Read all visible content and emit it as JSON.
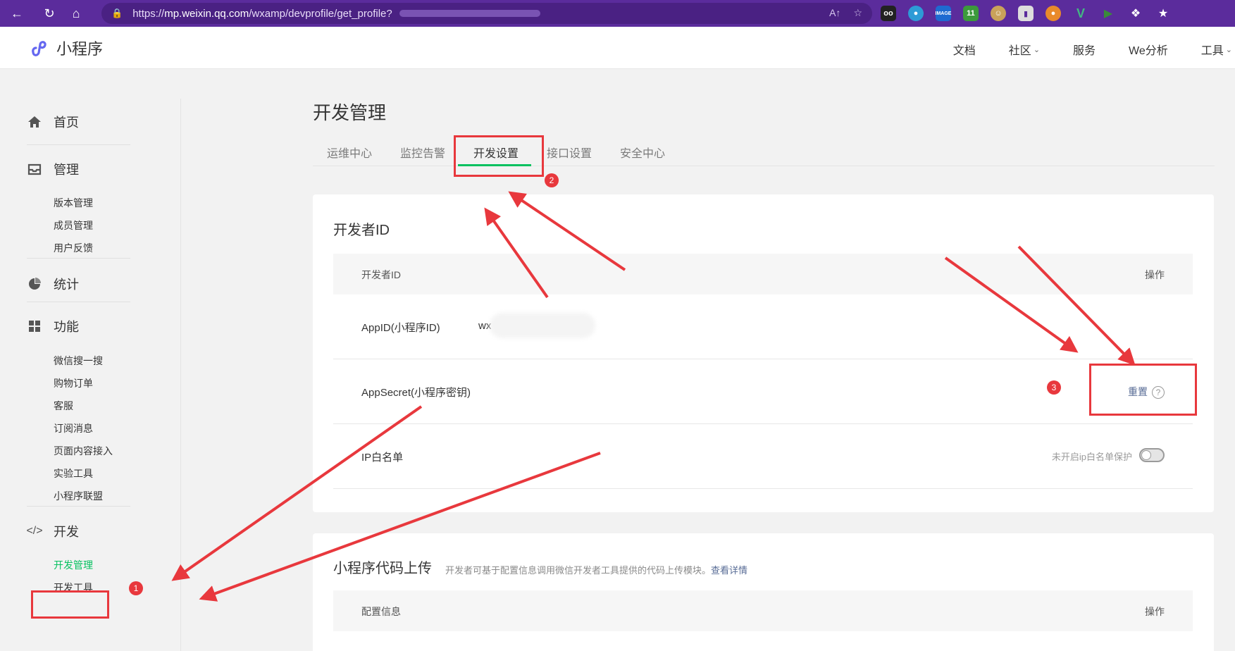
{
  "browser": {
    "url_prefix": "https://",
    "url_domain": "mp.weixin.qq.com",
    "url_path": "/wxamp/devprofile/get_profile?"
  },
  "header": {
    "logo_text": "小程序",
    "nav": [
      {
        "label": "文档"
      },
      {
        "label": "社区",
        "has_dropdown": true
      },
      {
        "label": "服务"
      },
      {
        "label": "We分析"
      },
      {
        "label": "工具",
        "has_dropdown": true
      }
    ]
  },
  "sidebar": {
    "home": "首页",
    "manage": {
      "label": "管理",
      "items": [
        "版本管理",
        "成员管理",
        "用户反馈"
      ]
    },
    "stats": "统计",
    "features": {
      "label": "功能",
      "items": [
        "微信搜一搜",
        "购物订单",
        "客服",
        "订阅消息",
        "页面内容接入",
        "实验工具",
        "小程序联盟"
      ]
    },
    "dev": {
      "label": "开发",
      "items": [
        "开发管理",
        "开发工具"
      ],
      "active": "开发管理"
    }
  },
  "main": {
    "page_title": "开发管理",
    "tabs": [
      "运维中心",
      "监控告警",
      "开发设置",
      "接口设置",
      "安全中心"
    ],
    "active_tab": "开发设置",
    "dev_id_card": {
      "title": "开发者ID",
      "col_left": "开发者ID",
      "col_right": "操作",
      "rows": {
        "appid_label": "AppID(小程序ID)",
        "appid_value": "wx",
        "appsecret_label": "AppSecret(小程序密钥)",
        "reset_link": "重置",
        "ip_label": "IP白名单",
        "ip_status": "未开启ip白名单保护"
      }
    },
    "upload_card": {
      "title": "小程序代码上传",
      "desc": "开发者可基于配置信息调用微信开发者工具提供的代码上传模块。",
      "link": "查看详情",
      "col_left": "配置信息",
      "col_right": "操作"
    }
  },
  "annotations": {
    "badge_1": "1",
    "badge_2": "2",
    "badge_3": "3",
    "color": "#e8383d"
  },
  "colors": {
    "brand": "#07c160",
    "link": "#576b95",
    "browser": "#5b2c9c"
  }
}
